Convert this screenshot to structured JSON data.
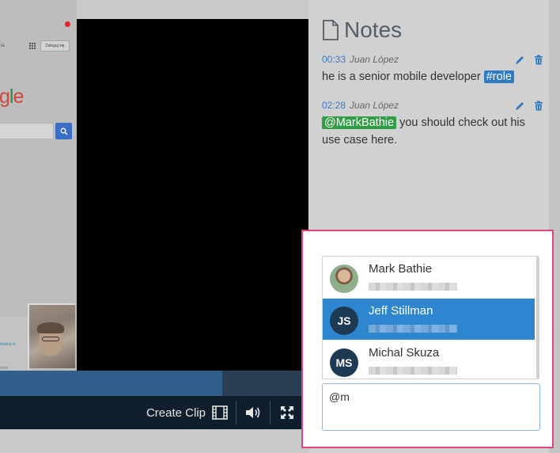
{
  "shared_screen": {
    "signin_label": "Zaloguj się",
    "corner_link": "ia",
    "logo_text": "gle",
    "footer_link": "kładnij to",
    "footer_small": "ność"
  },
  "player": {
    "progress_fraction": 0.72,
    "create_clip_label": "Create Clip",
    "icons": {
      "clip": "film-icon",
      "volume": "volume-icon",
      "fullscreen": "fullscreen-icon"
    }
  },
  "notes": {
    "title": "Notes",
    "items": [
      {
        "time": "00:33",
        "author": "Juan López",
        "text": "he is a senior mobile developer ",
        "hashtag": "#role"
      },
      {
        "time": "02:28",
        "author": "Juan López",
        "mention": "@MarkBathie",
        "text": " you should check out his use case here."
      }
    ]
  },
  "mention_popup": {
    "users": [
      {
        "name": "Mark Bathie",
        "initials": "",
        "active": false
      },
      {
        "name": "Jeff Stillman",
        "initials": "JS",
        "active": true
      },
      {
        "name": "Michal Skuza",
        "initials": "MS",
        "active": false
      }
    ],
    "input_value": "@m"
  },
  "colors": {
    "accent_blue": "#2e86cf",
    "mention_green": "#2f9e45",
    "highlight_pink": "#e0457b",
    "controls_bg": "#0f1e2c"
  }
}
